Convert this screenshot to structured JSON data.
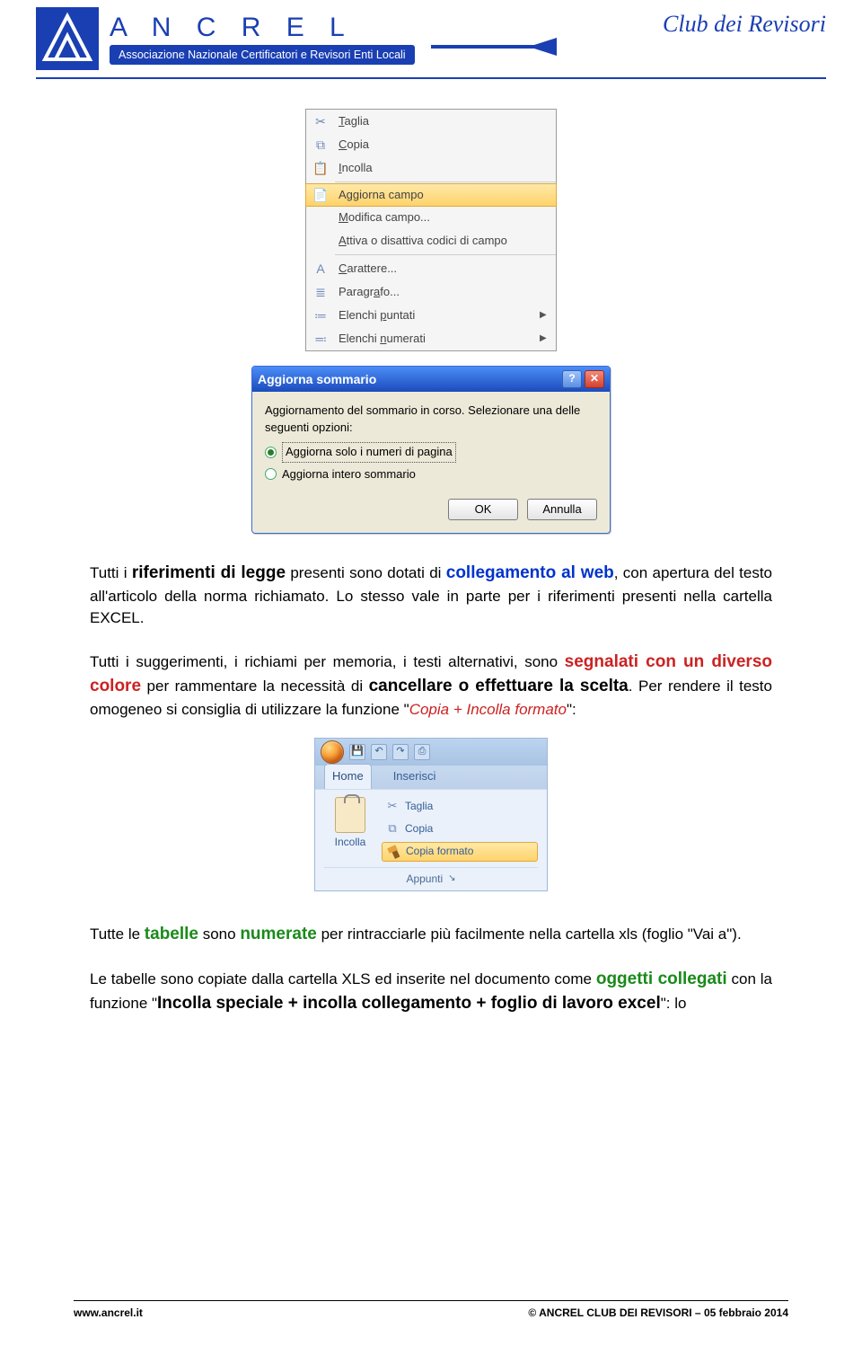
{
  "header": {
    "brand": "A N C R E L",
    "tagline": "Associazione Nazionale Certificatori e Revisori Enti Locali",
    "right": "Club dei Revisori"
  },
  "context_menu": {
    "items": [
      {
        "icon": "✂",
        "label": "Taglia",
        "ul": 0
      },
      {
        "icon": "⧉",
        "label": "Copia",
        "ul": 0
      },
      {
        "icon": "📋",
        "label": "Incolla",
        "ul": 0
      },
      {
        "sep": true
      },
      {
        "icon": "📄",
        "label": "Aggiorna campo",
        "hot": true,
        "ul": -1
      },
      {
        "icon": "",
        "label": "Modifica campo...",
        "ul": 0
      },
      {
        "icon": "",
        "label": "Attiva o disattiva codici di campo",
        "ul": 0
      },
      {
        "sep": true
      },
      {
        "icon": "A",
        "label": "Carattere...",
        "ul": 0
      },
      {
        "icon": "≣",
        "label": "Paragrafo...",
        "ul": 6
      },
      {
        "icon": "≔",
        "label": "Elenchi puntati",
        "ul": 8,
        "arrow": true
      },
      {
        "icon": "≕",
        "label": "Elenchi numerati",
        "ul": 8,
        "arrow": true
      }
    ]
  },
  "dialog": {
    "title": "Aggiorna sommario",
    "prompt": "Aggiornamento del sommario in corso. Selezionare una delle seguenti opzioni:",
    "opt1": "Aggiorna solo i numeri di pagina",
    "opt2": "Aggiorna intero sommario",
    "ok": "OK",
    "cancel": "Annulla"
  },
  "ribbon": {
    "tab_home": "Home",
    "tab_insert": "Inserisci",
    "cut": "Taglia",
    "copy": "Copia",
    "paste_fmt": "Copia formato",
    "paste_big": "Incolla",
    "section": "Appunti"
  },
  "text": {
    "p1a": "Tutti i ",
    "p1b": "riferimenti di legge",
    "p1c": " presenti sono dotati di ",
    "p1d": "collegamento al web",
    "p1e": ", con apertura del testo all'articolo della norma richiamato. Lo stesso vale in parte per i riferimenti presenti nella cartella EXCEL.",
    "p2a": "Tutti i suggerimenti, i richiami per memoria, i testi alternativi, sono ",
    "p2b": "segnalati con un diverso colore",
    "p2c": " per rammentare la necessità di ",
    "p2d": "cancellare o effettuare la scelta",
    "p2e": ". Per rendere il testo omogeneo si consiglia di utilizzare la funzione \"",
    "p2f": "Copia + Incolla formato",
    "p2g": "\":",
    "p3a": "Tutte le ",
    "p3b": "tabelle",
    "p3c": " sono ",
    "p3d": "numerate",
    "p3e": " per rintracciarle più facilmente nella cartella xls (foglio \"Vai a\").",
    "p4a": "Le tabelle sono copiate dalla cartella XLS ed inserite nel documento come ",
    "p4b": "oggetti collegati",
    "p4c": " con la funzione \"",
    "p4d": "Incolla speciale + incolla collegamento + foglio di lavoro excel",
    "p4e": "\": lo"
  },
  "footer": {
    "left": "www.ancrel.it",
    "right": "© ANCREL CLUB DEI REVISORI – 05 febbraio 2014"
  }
}
